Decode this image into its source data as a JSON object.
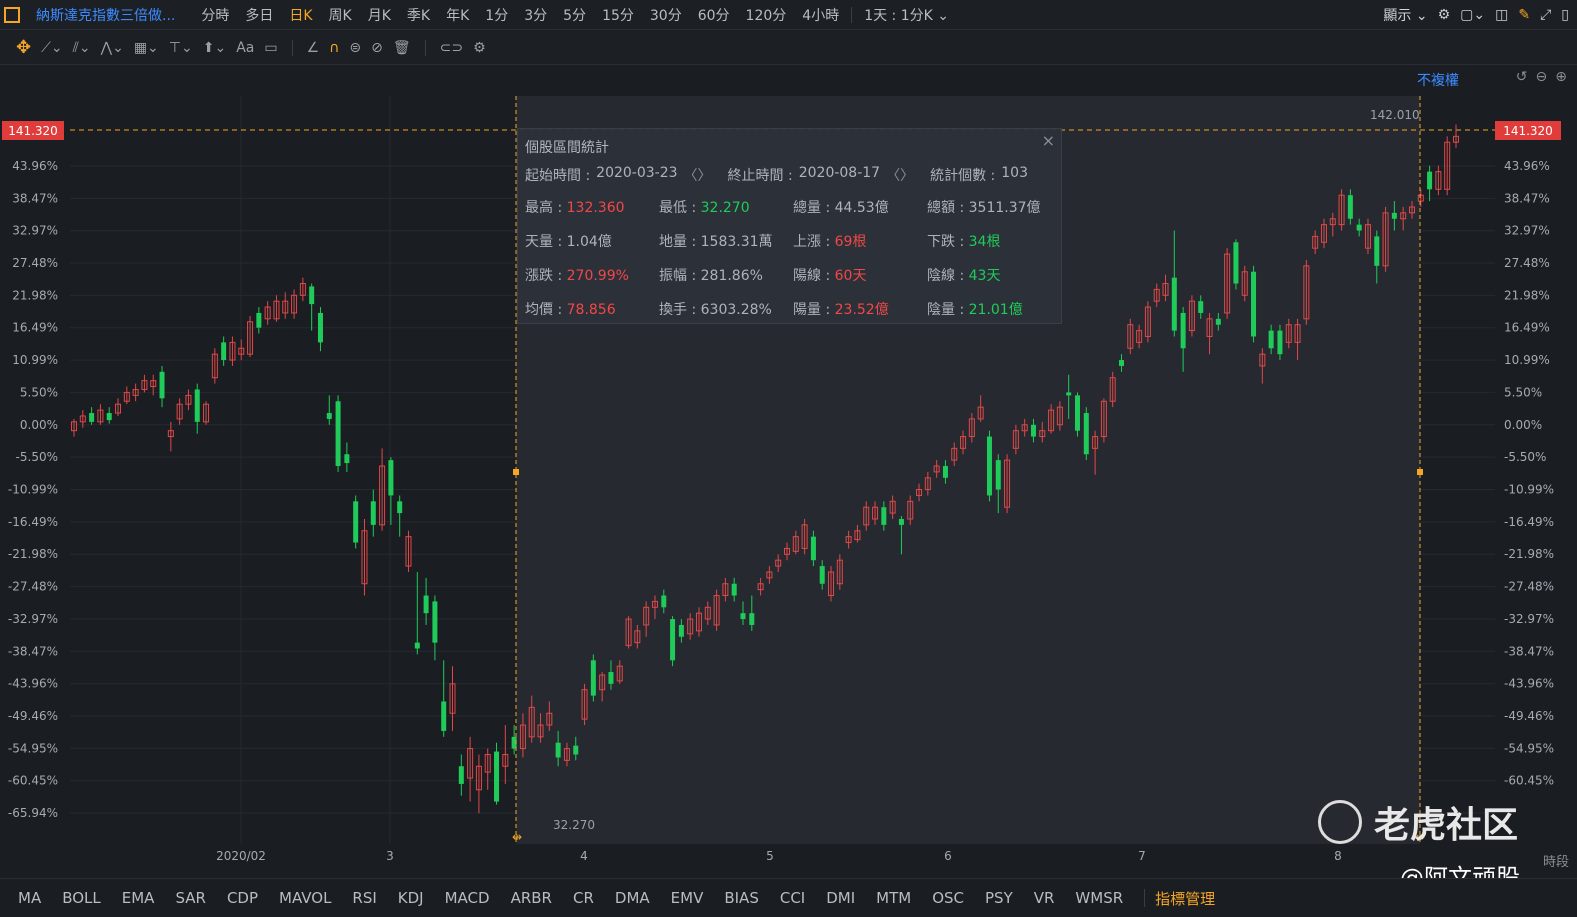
{
  "topbar": {
    "title": "納斯達克指數三倍做...",
    "timeframes": [
      "分時",
      "多日",
      "日K",
      "周K",
      "月K",
      "季K",
      "年K",
      "1分",
      "3分",
      "5分",
      "15分",
      "30分",
      "60分",
      "120分",
      "4小時"
    ],
    "active_timeframe": "日K",
    "period_select": "1天 : 1分K",
    "display_label": "顯示"
  },
  "chart_header": {
    "adjust_label": "不複權"
  },
  "axis": {
    "price_marker": "141.320",
    "left_ticks": [
      "43.96%",
      "38.47%",
      "32.97%",
      "27.48%",
      "21.98%",
      "16.49%",
      "10.99%",
      "5.50%",
      "0.00%",
      "-5.50%",
      "-10.99%",
      "-16.49%",
      "-21.98%",
      "-27.48%",
      "-32.97%",
      "-38.47%",
      "-43.96%",
      "-49.46%",
      "-54.95%",
      "-60.45%",
      "-65.94%"
    ],
    "right_ticks": [
      "43.96%",
      "38.47%",
      "32.97%",
      "27.48%",
      "21.98%",
      "16.49%",
      "10.99%",
      "5.50%",
      "0.00%",
      "-5.50%",
      "-10.99%",
      "-16.49%",
      "-21.98%",
      "-27.48%",
      "-32.97%",
      "-38.47%",
      "-43.96%",
      "-49.46%",
      "-54.95%",
      "-60.45%"
    ],
    "x_ticks": [
      "2020/02",
      "3",
      "4",
      "5",
      "6",
      "7",
      "8"
    ],
    "high_label": "142.010",
    "low_label": "32.270",
    "time_label": "時段"
  },
  "stats": {
    "title": "個股區間統計",
    "start_label": "起始時間 :",
    "start_value": "2020-03-23",
    "end_label": "終止時間 :",
    "end_value": "2020-08-17",
    "count_label": "統計個數 :",
    "count_value": "103",
    "rows": [
      [
        {
          "label": "最高 : ",
          "value": "132.360",
          "color": "red"
        },
        {
          "label": "最低 : ",
          "value": "32.270",
          "color": "green"
        },
        {
          "label": "總量 : ",
          "value": "44.53億",
          "color": "white"
        },
        {
          "label": "總額 : ",
          "value": "3511.37億",
          "color": "white"
        }
      ],
      [
        {
          "label": "天量 : ",
          "value": "1.04億",
          "color": "white"
        },
        {
          "label": "地量 : ",
          "value": "1583.31萬",
          "color": "white"
        },
        {
          "label": "上漲 : ",
          "value": "69根",
          "color": "red"
        },
        {
          "label": "下跌 : ",
          "value": "34根",
          "color": "green"
        }
      ],
      [
        {
          "label": "漲跌 : ",
          "value": "270.99%",
          "color": "red"
        },
        {
          "label": "振幅 : ",
          "value": "281.86%",
          "color": "white"
        },
        {
          "label": "陽線 : ",
          "value": "60天",
          "color": "red"
        },
        {
          "label": "陰線 : ",
          "value": "43天",
          "color": "green"
        }
      ],
      [
        {
          "label": "均價 : ",
          "value": "78.856",
          "color": "red"
        },
        {
          "label": "換手 : ",
          "value": "6303.28%",
          "color": "white"
        },
        {
          "label": "陽量 : ",
          "value": "23.52億",
          "color": "red"
        },
        {
          "label": "陰量 : ",
          "value": "21.01億",
          "color": "green"
        }
      ]
    ]
  },
  "indicators": [
    "MA",
    "BOLL",
    "EMA",
    "SAR",
    "CDP",
    "MAVOL",
    "RSI",
    "KDJ",
    "MACD",
    "ARBR",
    "CR",
    "DMA",
    "EMV",
    "BIAS",
    "CCI",
    "DMI",
    "MTM",
    "OSC",
    "PSY",
    "VR",
    "WMSR"
  ],
  "indicator_manager": "指標管理",
  "watermark": {
    "brand": "老虎社区",
    "handle": "@阿文顽股"
  },
  "chart_data": {
    "type": "candlestick",
    "ylabel": "",
    "y_unit": "% change",
    "ylim": [
      -66,
      46
    ],
    "candles": [
      {
        "o": -1.0,
        "c": 0.5,
        "h": 1.0,
        "l": -2.0
      },
      {
        "o": 0.5,
        "c": 1.5,
        "h": 2.5,
        "l": -0.5
      },
      {
        "o": 2.0,
        "c": 0.5,
        "h": 3.0,
        "l": 0.0
      },
      {
        "o": 0.5,
        "c": 2.5,
        "h": 3.5,
        "l": 0.0
      },
      {
        "o": 2.0,
        "c": 0.8,
        "h": 3.0,
        "l": 0.2
      },
      {
        "o": 2.0,
        "c": 3.5,
        "h": 4.5,
        "l": 1.5
      },
      {
        "o": 4.0,
        "c": 5.5,
        "h": 6.5,
        "l": 3.5
      },
      {
        "o": 5.0,
        "c": 6.0,
        "h": 7.0,
        "l": 4.0
      },
      {
        "o": 6.0,
        "c": 7.5,
        "h": 8.5,
        "l": 5.5
      },
      {
        "o": 6.5,
        "c": 7.5,
        "h": 8.5,
        "l": 5.0
      },
      {
        "o": 9.0,
        "c": 4.5,
        "h": 10.0,
        "l": 3.0
      },
      {
        "o": -2.0,
        "c": -1.0,
        "h": 0.5,
        "l": -4.5
      },
      {
        "o": 1.0,
        "c": 3.5,
        "h": 4.5,
        "l": 0.0
      },
      {
        "o": 3.5,
        "c": 5.0,
        "h": 6.0,
        "l": 2.5
      },
      {
        "o": 6.0,
        "c": 0.5,
        "h": 7.0,
        "l": -1.5
      },
      {
        "o": 0.5,
        "c": 3.5,
        "h": 4.0,
        "l": 0.0
      },
      {
        "o": 8.0,
        "c": 12.0,
        "h": 13.0,
        "l": 7.0
      },
      {
        "o": 14.0,
        "c": 11.0,
        "h": 15.0,
        "l": 10.0
      },
      {
        "o": 11.0,
        "c": 14.0,
        "h": 15.0,
        "l": 10.0
      },
      {
        "o": 12.0,
        "c": 13.0,
        "h": 14.5,
        "l": 11.0
      },
      {
        "o": 12.0,
        "c": 17.5,
        "h": 18.5,
        "l": 11.5
      },
      {
        "o": 19.0,
        "c": 16.5,
        "h": 20.0,
        "l": 15.5
      },
      {
        "o": 18.0,
        "c": 20.0,
        "h": 21.0,
        "l": 17.0
      },
      {
        "o": 18.0,
        "c": 21.0,
        "h": 22.0,
        "l": 17.5
      },
      {
        "o": 19.0,
        "c": 21.0,
        "h": 22.5,
        "l": 18.0
      },
      {
        "o": 19.0,
        "c": 22.0,
        "h": 23.0,
        "l": 18.0
      },
      {
        "o": 22.0,
        "c": 24.0,
        "h": 25.0,
        "l": 21.0
      },
      {
        "o": 23.5,
        "c": 20.5,
        "h": 24.0,
        "l": 16.0
      },
      {
        "o": 19.0,
        "c": 14.0,
        "h": 20.0,
        "l": 12.5
      },
      {
        "o": 2.0,
        "c": 1.0,
        "h": 5.0,
        "l": 0.0
      },
      {
        "o": 4.0,
        "c": -7.0,
        "h": 5.0,
        "l": -8.0
      },
      {
        "o": -5.0,
        "c": -6.5,
        "h": -3.0,
        "l": -8.0
      },
      {
        "o": -13.0,
        "c": -20.0,
        "h": -12.0,
        "l": -21.0
      },
      {
        "o": -27.0,
        "c": -18.0,
        "h": -16.0,
        "l": -29.0
      },
      {
        "o": -13.0,
        "c": -17.0,
        "h": -11.0,
        "l": -19.0
      },
      {
        "o": -17.0,
        "c": -7.0,
        "h": -4.0,
        "l": -18.0
      },
      {
        "o": -6.0,
        "c": -12.0,
        "h": -5.5,
        "l": -17.0
      },
      {
        "o": -13.0,
        "c": -15.0,
        "h": -12.0,
        "l": -19.0
      },
      {
        "o": -24.0,
        "c": -19.0,
        "h": -18.0,
        "l": -25.0
      },
      {
        "o": -37.0,
        "c": -38.0,
        "h": -25.0,
        "l": -39.0
      },
      {
        "o": -29.0,
        "c": -32.0,
        "h": -26.0,
        "l": -34.0
      },
      {
        "o": -30.0,
        "c": -37.0,
        "h": -29.0,
        "l": -40.0
      },
      {
        "o": -47.0,
        "c": -52.0,
        "h": -40.0,
        "l": -53.0
      },
      {
        "o": -49.0,
        "c": -44.0,
        "h": -41.0,
        "l": -52.0
      },
      {
        "o": -58.0,
        "c": -61.0,
        "h": -56.0,
        "l": -63.0
      },
      {
        "o": -60.0,
        "c": -55.0,
        "h": -53.0,
        "l": -64.0
      },
      {
        "o": -62.0,
        "c": -58.0,
        "h": -56.0,
        "l": -66.0
      },
      {
        "o": -59.0,
        "c": -56.0,
        "h": -55.0,
        "l": -62.0
      },
      {
        "o": -55.5,
        "c": -64.0,
        "h": -54.0,
        "l": -64.5
      },
      {
        "o": -58.0,
        "c": -56.0,
        "h": -51.0,
        "l": -61.0
      },
      {
        "o": -53.0,
        "c": -55.0,
        "h": -51.0,
        "l": -56.0
      },
      {
        "o": -55.0,
        "c": -51.0,
        "h": -49.0,
        "l": -56.5
      },
      {
        "o": -53.0,
        "c": -48.0,
        "h": -46.0,
        "l": -54.0
      },
      {
        "o": -53.0,
        "c": -51.0,
        "h": -49.0,
        "l": -54.0
      },
      {
        "o": -51.0,
        "c": -49.0,
        "h": -47.0,
        "l": -52.0
      },
      {
        "o": -54.0,
        "c": -56.5,
        "h": -52.0,
        "l": -58.0
      },
      {
        "o": -57.0,
        "c": -55.0,
        "h": -54.0,
        "l": -58.0
      },
      {
        "o": -54.5,
        "c": -56.0,
        "h": -53.0,
        "l": -57.0
      },
      {
        "o": -50.0,
        "c": -45.0,
        "h": -44.0,
        "l": -51.0
      },
      {
        "o": -40.0,
        "c": -46.0,
        "h": -39.0,
        "l": -47.0
      },
      {
        "o": -45.0,
        "c": -42.5,
        "h": -42.0,
        "l": -47.0
      },
      {
        "o": -42.0,
        "c": -44.0,
        "h": -40.0,
        "l": -45.0
      },
      {
        "o": -43.5,
        "c": -41.0,
        "h": -40.0,
        "l": -44.0
      },
      {
        "o": -37.5,
        "c": -33.0,
        "h": -32.5,
        "l": -38.0
      },
      {
        "o": -37.0,
        "c": -35.0,
        "h": -34.0,
        "l": -38.0
      },
      {
        "o": -34.0,
        "c": -31.0,
        "h": -30.0,
        "l": -36.0
      },
      {
        "o": -31.0,
        "c": -30.0,
        "h": -29.0,
        "l": -33.0
      },
      {
        "o": -29.0,
        "c": -31.0,
        "h": -28.0,
        "l": -32.0
      },
      {
        "o": -33.0,
        "c": -40.0,
        "h": -32.5,
        "l": -41.0
      },
      {
        "o": -34.0,
        "c": -36.0,
        "h": -33.0,
        "l": -37.0
      },
      {
        "o": -35.5,
        "c": -33.0,
        "h": -32.0,
        "l": -36.5
      },
      {
        "o": -35.0,
        "c": -32.0,
        "h": -31.0,
        "l": -36.0
      },
      {
        "o": -33.0,
        "c": -31.0,
        "h": -30.0,
        "l": -34.0
      },
      {
        "o": -34.0,
        "c": -29.0,
        "h": -28.0,
        "l": -35.0
      },
      {
        "o": -29.0,
        "c": -27.0,
        "h": -26.0,
        "l": -30.0
      },
      {
        "o": -27.0,
        "c": -29.0,
        "h": -26.0,
        "l": -30.0
      },
      {
        "o": -32.0,
        "c": -33.0,
        "h": -30.0,
        "l": -34.0
      },
      {
        "o": -32.0,
        "c": -34.0,
        "h": -29.0,
        "l": -35.0
      },
      {
        "o": -28.0,
        "c": -27.0,
        "h": -26.0,
        "l": -29.0
      },
      {
        "o": -26.0,
        "c": -25.0,
        "h": -24.0,
        "l": -27.0
      },
      {
        "o": -24.0,
        "c": -23.0,
        "h": -22.0,
        "l": -25.0
      },
      {
        "o": -22.0,
        "c": -21.0,
        "h": -20.0,
        "l": -23.0
      },
      {
        "o": -21.5,
        "c": -19.0,
        "h": -18.0,
        "l": -22.0
      },
      {
        "o": -21.0,
        "c": -17.0,
        "h": -16.0,
        "l": -22.0
      },
      {
        "o": -19.0,
        "c": -23.0,
        "h": -18.0,
        "l": -24.0
      },
      {
        "o": -24.0,
        "c": -27.0,
        "h": -23.0,
        "l": -28.0
      },
      {
        "o": -29.0,
        "c": -25.0,
        "h": -24.0,
        "l": -30.0
      },
      {
        "o": -27.0,
        "c": -23.0,
        "h": -22.0,
        "l": -28.0
      },
      {
        "o": -20.0,
        "c": -19.0,
        "h": -18.0,
        "l": -21.0
      },
      {
        "o": -19.5,
        "c": -18.0,
        "h": -17.0,
        "l": -20.0
      },
      {
        "o": -17.0,
        "c": -14.0,
        "h": -13.0,
        "l": -18.0
      },
      {
        "o": -16.0,
        "c": -14.0,
        "h": -13.0,
        "l": -17.0
      },
      {
        "o": -14.0,
        "c": -17.0,
        "h": -13.0,
        "l": -18.0
      },
      {
        "o": -15.0,
        "c": -13.0,
        "h": -12.0,
        "l": -16.0
      },
      {
        "o": -16.0,
        "c": -17.0,
        "h": -15.5,
        "l": -22.0
      },
      {
        "o": -16.0,
        "c": -13.0,
        "h": -12.0,
        "l": -17.0
      },
      {
        "o": -12.0,
        "c": -11.0,
        "h": -10.0,
        "l": -13.0
      },
      {
        "o": -11.0,
        "c": -9.0,
        "h": -8.0,
        "l": -12.0
      },
      {
        "o": -8.0,
        "c": -7.0,
        "h": -6.0,
        "l": -9.0
      },
      {
        "o": -7.0,
        "c": -9.0,
        "h": -6.0,
        "l": -10.0
      },
      {
        "o": -6.0,
        "c": -4.0,
        "h": -3.0,
        "l": -7.0
      },
      {
        "o": -4.0,
        "c": -2.0,
        "h": -1.0,
        "l": -5.0
      },
      {
        "o": -2.0,
        "c": 1.0,
        "h": 2.0,
        "l": -3.0
      },
      {
        "o": 1.0,
        "c": 3.0,
        "h": 5.0,
        "l": 0.5
      },
      {
        "o": -2.0,
        "c": -12.0,
        "h": -1.0,
        "l": -13.0
      },
      {
        "o": -6.0,
        "c": -11.0,
        "h": -5.0,
        "l": -15.0
      },
      {
        "o": -14.0,
        "c": -6.0,
        "h": -5.0,
        "l": -15.0
      },
      {
        "o": -4.0,
        "c": -1.0,
        "h": 0.0,
        "l": -5.0
      },
      {
        "o": -1.0,
        "c": 0.0,
        "h": 1.0,
        "l": -2.0
      },
      {
        "o": 0.0,
        "c": -2.0,
        "h": 1.0,
        "l": -3.0
      },
      {
        "o": -2.0,
        "c": -1.0,
        "h": 0.5,
        "l": -3.0
      },
      {
        "o": -1.0,
        "c": 2.5,
        "h": 3.5,
        "l": -1.5
      },
      {
        "o": 0.0,
        "c": 3.0,
        "h": 4.0,
        "l": -1.0
      },
      {
        "o": 5.5,
        "c": 5.0,
        "h": 8.5,
        "l": 1.0
      },
      {
        "o": 5.0,
        "c": -1.0,
        "h": 5.5,
        "l": -2.0
      },
      {
        "o": 2.0,
        "c": -5.0,
        "h": 3.0,
        "l": -6.0
      },
      {
        "o": -4.0,
        "c": -2.0,
        "h": -1.0,
        "l": -8.5
      },
      {
        "o": -2.0,
        "c": 4.0,
        "h": 4.5,
        "l": -3.0
      },
      {
        "o": 4.0,
        "c": 8.0,
        "h": 9.0,
        "l": 3.0
      },
      {
        "o": 11.0,
        "c": 10.0,
        "h": 12.0,
        "l": 9.0
      },
      {
        "o": 13.0,
        "c": 17.0,
        "h": 18.0,
        "l": 12.0
      },
      {
        "o": 14.0,
        "c": 16.0,
        "h": 17.0,
        "l": 13.0
      },
      {
        "o": 15.0,
        "c": 20.0,
        "h": 21.0,
        "l": 14.0
      },
      {
        "o": 21.0,
        "c": 23.0,
        "h": 24.0,
        "l": 20.0
      },
      {
        "o": 22.0,
        "c": 24.0,
        "h": 25.5,
        "l": 21.0
      },
      {
        "o": 25.0,
        "c": 16.0,
        "h": 33.0,
        "l": 15.0
      },
      {
        "o": 19.0,
        "c": 13.0,
        "h": 20.0,
        "l": 9.0
      },
      {
        "o": 16.0,
        "c": 21.0,
        "h": 22.0,
        "l": 15.0
      },
      {
        "o": 21.0,
        "c": 19.0,
        "h": 22.0,
        "l": 18.0
      },
      {
        "o": 15.0,
        "c": 18.0,
        "h": 19.0,
        "l": 12.0
      },
      {
        "o": 18.0,
        "c": 17.0,
        "h": 19.0,
        "l": 16.0
      },
      {
        "o": 19.0,
        "c": 29.0,
        "h": 30.0,
        "l": 18.0
      },
      {
        "o": 31.0,
        "c": 24.0,
        "h": 31.5,
        "l": 23.0
      },
      {
        "o": 22.0,
        "c": 26.0,
        "h": 27.0,
        "l": 21.0
      },
      {
        "o": 26.0,
        "c": 15.0,
        "h": 27.0,
        "l": 14.0
      },
      {
        "o": 10.0,
        "c": 12.0,
        "h": 13.0,
        "l": 7.0
      },
      {
        "o": 16.0,
        "c": 13.0,
        "h": 17.0,
        "l": 12.0
      },
      {
        "o": 16.0,
        "c": 12.0,
        "h": 17.0,
        "l": 11.0
      },
      {
        "o": 14.0,
        "c": 17.0,
        "h": 18.0,
        "l": 13.0
      },
      {
        "o": 14.0,
        "c": 17.0,
        "h": 18.0,
        "l": 11.0
      },
      {
        "o": 18.0,
        "c": 27.0,
        "h": 28.0,
        "l": 17.0
      },
      {
        "o": 30.0,
        "c": 32.0,
        "h": 33.0,
        "l": 29.0
      },
      {
        "o": 31.0,
        "c": 34.0,
        "h": 35.0,
        "l": 30.0
      },
      {
        "o": 34.0,
        "c": 35.0,
        "h": 36.0,
        "l": 32.0
      },
      {
        "o": 34.0,
        "c": 39.0,
        "h": 40.0,
        "l": 33.0
      },
      {
        "o": 39.0,
        "c": 35.0,
        "h": 40.0,
        "l": 34.0
      },
      {
        "o": 34.0,
        "c": 33.0,
        "h": 35.0,
        "l": 32.0
      },
      {
        "o": 30.0,
        "c": 34.0,
        "h": 35.0,
        "l": 29.0
      },
      {
        "o": 32.0,
        "c": 27.0,
        "h": 33.0,
        "l": 24.0
      },
      {
        "o": 27.0,
        "c": 36.0,
        "h": 37.0,
        "l": 26.0
      },
      {
        "o": 36.0,
        "c": 35.0,
        "h": 38.0,
        "l": 33.0
      },
      {
        "o": 35.0,
        "c": 36.0,
        "h": 37.0,
        "l": 33.0
      },
      {
        "o": 36.0,
        "c": 37.0,
        "h": 38.0,
        "l": 35.0
      },
      {
        "o": 38.0,
        "c": 39.0,
        "h": 40.0,
        "l": 37.0
      },
      {
        "o": 43.0,
        "c": 40.0,
        "h": 44.0,
        "l": 38.0
      },
      {
        "o": 40.0,
        "c": 43.0,
        "h": 44.0,
        "l": 39.0
      },
      {
        "o": 40.0,
        "c": 48.0,
        "h": 49.0,
        "l": 39.0
      },
      {
        "o": 48.0,
        "c": 49.0,
        "h": 51.0,
        "l": 47.0
      }
    ]
  }
}
